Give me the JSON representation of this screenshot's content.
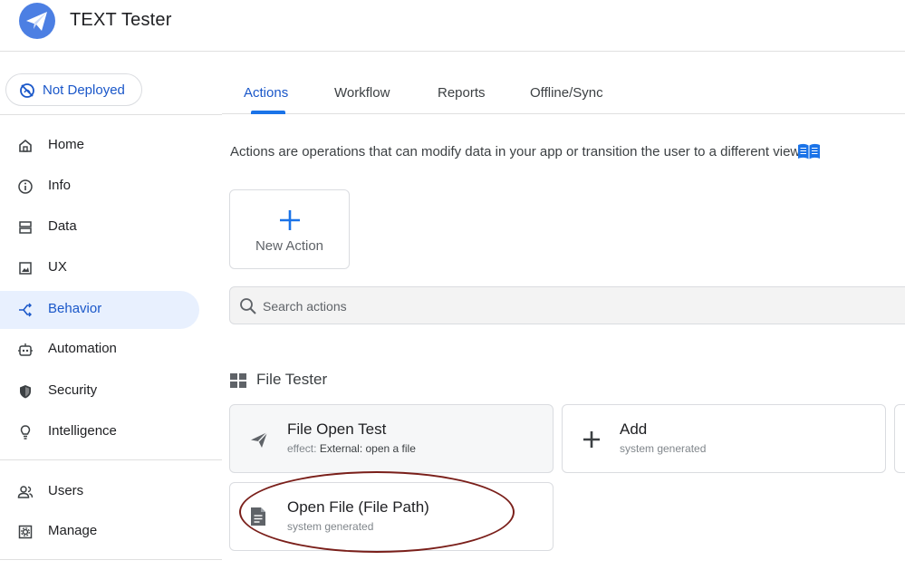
{
  "app": {
    "title": "TEXT Tester",
    "logo_icon": "paper-plane-icon"
  },
  "deploy_status": {
    "label": "Not Deployed",
    "icon": "not-deployed-icon",
    "color": "#1a57c9"
  },
  "sidebar": {
    "items": [
      {
        "label": "Home",
        "icon": "home-icon"
      },
      {
        "label": "Info",
        "icon": "info-icon"
      },
      {
        "label": "Data",
        "icon": "data-icon"
      },
      {
        "label": "UX",
        "icon": "image-icon"
      },
      {
        "label": "Behavior",
        "icon": "behavior-icon",
        "active": true
      },
      {
        "label": "Automation",
        "icon": "robot-icon"
      },
      {
        "label": "Security",
        "icon": "shield-icon"
      },
      {
        "label": "Intelligence",
        "icon": "lightbulb-icon"
      },
      {
        "label": "Users",
        "icon": "users-icon"
      },
      {
        "label": "Manage",
        "icon": "manage-icon"
      }
    ]
  },
  "tabs": [
    {
      "label": "Actions",
      "active": true
    },
    {
      "label": "Workflow"
    },
    {
      "label": "Reports"
    },
    {
      "label": "Offline/Sync"
    }
  ],
  "main": {
    "intro": "Actions are operations that can modify data in your app or transition the user to a different view",
    "new_action_label": "New Action",
    "search_placeholder": "Search actions",
    "group_title": "File Tester",
    "cards": [
      {
        "title": "File Open Test",
        "effect_prefix": "effect:",
        "effect_value": "External: open a file",
        "icon": "send-icon"
      },
      {
        "title": "Add",
        "subtitle": "system generated",
        "icon": "plus-icon"
      },
      {
        "title": "Open File (File Path)",
        "subtitle": "system generated",
        "icon": "document-icon"
      }
    ]
  },
  "colors": {
    "accent": "#1a73e8",
    "active_bg": "#e8f0fe",
    "highlight": "#7a1f1a"
  }
}
